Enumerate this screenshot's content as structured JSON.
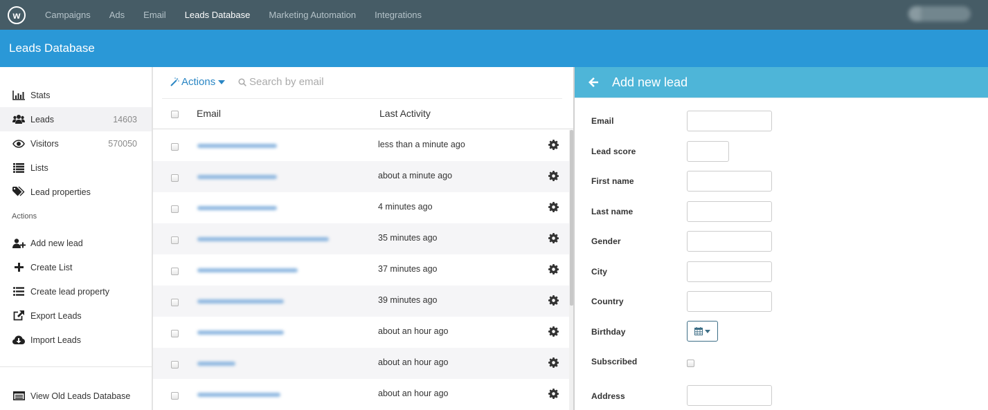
{
  "topnav": {
    "logo_letter": "w",
    "items": [
      {
        "label": "Campaigns",
        "active": false
      },
      {
        "label": "Ads",
        "active": false
      },
      {
        "label": "Email",
        "active": false
      },
      {
        "label": "Leads Database",
        "active": true
      },
      {
        "label": "Marketing Automation",
        "active": false
      },
      {
        "label": "Integrations",
        "active": false
      }
    ]
  },
  "titlebar": {
    "title": "Leads Database"
  },
  "sidebar": {
    "nav": [
      {
        "label": "Stats",
        "icon": "bar-chart-icon",
        "count": ""
      },
      {
        "label": "Leads",
        "icon": "users-icon",
        "count": "14603",
        "active": true
      },
      {
        "label": "Visitors",
        "icon": "eye-icon",
        "count": "570050"
      },
      {
        "label": "Lists",
        "icon": "list-icon",
        "count": ""
      },
      {
        "label": "Lead properties",
        "icon": "tags-icon",
        "count": ""
      }
    ],
    "actions_heading": "Actions",
    "actions": [
      {
        "label": "Add new lead",
        "icon": "user-plus-icon"
      },
      {
        "label": "Create List",
        "icon": "plus-icon"
      },
      {
        "label": "Create lead property",
        "icon": "list-ul-icon"
      },
      {
        "label": "Export Leads",
        "icon": "external-link-icon"
      },
      {
        "label": "Import Leads",
        "icon": "cloud-download-icon"
      }
    ],
    "footer_link": {
      "label": "View Old Leads Database",
      "icon": "list-alt-icon"
    }
  },
  "leads_list": {
    "actions_label": "Actions",
    "search_placeholder": "Search by email",
    "columns": {
      "email": "Email",
      "last_activity": "Last Activity"
    },
    "rows": [
      {
        "email": "[blurred]",
        "last_activity": "less than a minute ago"
      },
      {
        "email": "[blurred]",
        "last_activity": "about a minute ago"
      },
      {
        "email": "[blurred]",
        "last_activity": "4 minutes ago"
      },
      {
        "email": "[blurred]",
        "last_activity": "35 minutes ago"
      },
      {
        "email": "[blurred]",
        "last_activity": "37 minutes ago"
      },
      {
        "email": "[blurred]",
        "last_activity": "39 minutes ago"
      },
      {
        "email": "[blurred]",
        "last_activity": "about an hour ago"
      },
      {
        "email": "[blurred]",
        "last_activity": "about an hour ago"
      },
      {
        "email": "[blurred]",
        "last_activity": "about an hour ago"
      }
    ]
  },
  "add_lead_panel": {
    "title": "Add new lead",
    "fields": {
      "email": {
        "label": "Email",
        "value": ""
      },
      "lead_score": {
        "label": "Lead score",
        "value": ""
      },
      "first_name": {
        "label": "First name",
        "value": ""
      },
      "last_name": {
        "label": "Last name",
        "value": ""
      },
      "gender": {
        "label": "Gender",
        "value": ""
      },
      "city": {
        "label": "City",
        "value": ""
      },
      "country": {
        "label": "Country",
        "value": ""
      },
      "birthday": {
        "label": "Birthday",
        "value": ""
      },
      "subscribed": {
        "label": "Subscribed",
        "checked": false
      },
      "address": {
        "label": "Address",
        "value": ""
      }
    }
  },
  "colors": {
    "topnav_bg": "#465c66",
    "titlebar_bg": "#2a98d7",
    "panel_header_bg": "#4eb5d8",
    "link_blue": "#2a86c4"
  }
}
